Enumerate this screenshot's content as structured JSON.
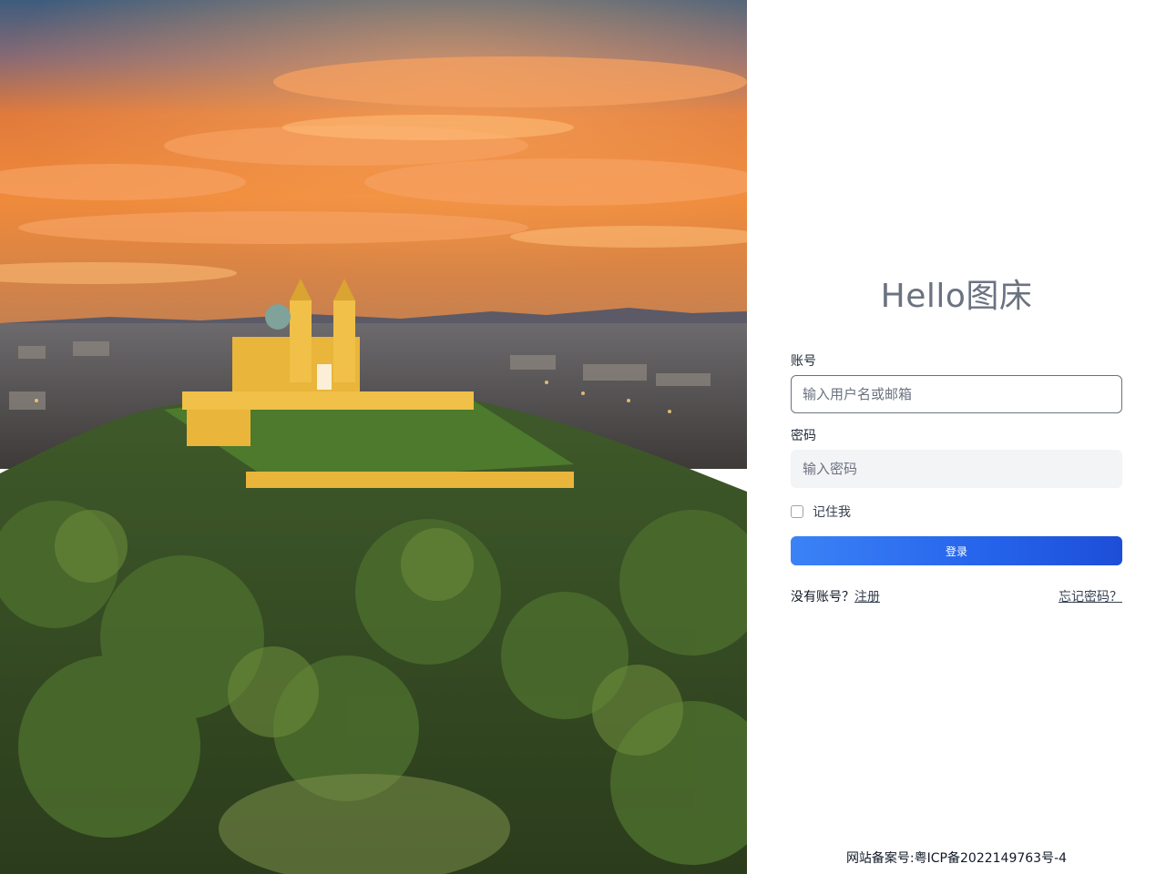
{
  "login": {
    "title": "Hello图床",
    "account_label": "账号",
    "account_placeholder": "输入用户名或邮箱",
    "password_label": "密码",
    "password_placeholder": "输入密码",
    "remember_label": "记住我",
    "remember_checked": false,
    "submit_label": "登录",
    "no_account_text": "没有账号？",
    "register_link": "注册",
    "forgot_link": "忘记密码？"
  },
  "footer": {
    "icp_text": "网站备案号:粤ICP备2022149763号-4"
  },
  "colors": {
    "title": "#6b7280",
    "button_start": "#3b82f6",
    "button_end": "#1d4ed8",
    "input_border_focus": "#6b7280",
    "input_bg_filled": "#f3f4f6"
  }
}
